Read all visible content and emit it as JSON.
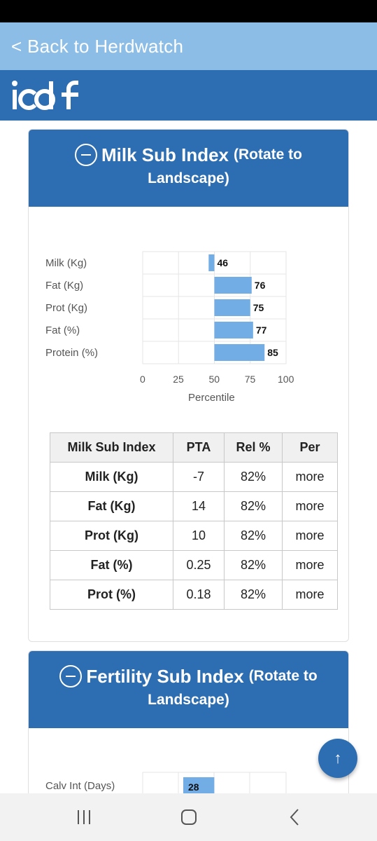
{
  "back_link": "< Back to Herdwatch",
  "brand": {
    "logo_text": "icbf"
  },
  "milk_card": {
    "title": "Milk Sub Index",
    "subtitle_1": "(Rotate to",
    "subtitle_2": "Landscape)"
  },
  "chart_data": {
    "type": "bar",
    "orientation": "horizontal",
    "categories": [
      "Milk (Kg)",
      "Fat (Kg)",
      "Prot (Kg)",
      "Fat (%)",
      "Protein (%)"
    ],
    "values": [
      46,
      76,
      75,
      77,
      85
    ],
    "value_labels": [
      "46",
      "76",
      "75",
      "77",
      "85"
    ],
    "xlabel": "Percentile",
    "xticks": [
      "0",
      "25",
      "50",
      "75",
      "100"
    ],
    "xlim": [
      0,
      100
    ],
    "bar_origin": 50,
    "bar_color": "#72ade6"
  },
  "table": {
    "headers": [
      "Milk Sub Index",
      "PTA",
      "Rel %",
      "Per"
    ],
    "rows": [
      [
        "Milk (Kg)",
        "-7",
        "82%",
        "more"
      ],
      [
        "Fat (Kg)",
        "14",
        "82%",
        "more"
      ],
      [
        "Prot (Kg)",
        "10",
        "82%",
        "more"
      ],
      [
        "Fat (%)",
        "0.25",
        "82%",
        "more"
      ],
      [
        "Prot (%)",
        "0.18",
        "82%",
        "more"
      ]
    ]
  },
  "fertility_card": {
    "title": "Fertility Sub Index",
    "subtitle_1": "(Rotate to",
    "subtitle_2": "Landscape)",
    "first_row_label": "Calv Int (Days)",
    "first_row_value": "28",
    "first_row_percentile": 28
  },
  "fab": {
    "icon": "arrow-up-icon",
    "glyph": "↑"
  },
  "navbar": {
    "icons": [
      "recent-apps-icon",
      "home-icon",
      "back-icon"
    ]
  },
  "colors": {
    "header_blue": "#2d6db1",
    "back_bar": "#8cbde6",
    "bar": "#72ade6"
  }
}
